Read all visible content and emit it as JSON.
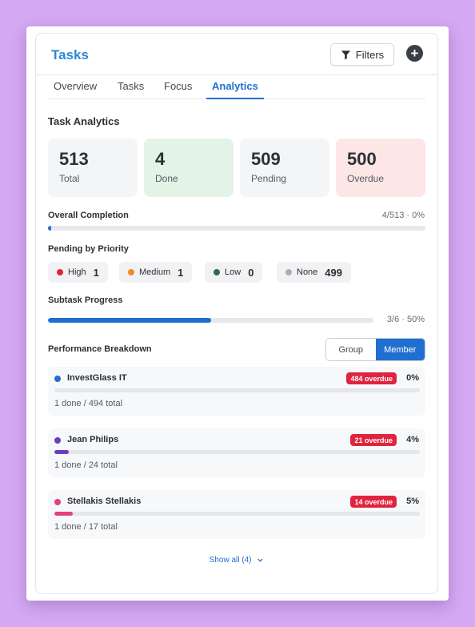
{
  "header": {
    "title": "Tasks",
    "filters_label": "Filters",
    "add_symbol": "+"
  },
  "tabs": [
    "Overview",
    "Tasks",
    "Focus",
    "Analytics"
  ],
  "active_tab": "Analytics",
  "analytics": {
    "title": "Task Analytics",
    "stats": [
      {
        "value": "513",
        "label": "Total",
        "bg": "#f4f5f6"
      },
      {
        "value": "4",
        "label": "Done",
        "bg": "#e3f3e6"
      },
      {
        "value": "509",
        "label": "Pending",
        "bg": "#f4f5f6"
      },
      {
        "value": "500",
        "label": "Overdue",
        "bg": "#fde6e6"
      }
    ],
    "completion": {
      "label": "Overall Completion",
      "summary": "4/513 · 0%",
      "fraction": 0.0078
    },
    "priority": {
      "label": "Pending by Priority",
      "items": [
        {
          "name": "High",
          "count": "1",
          "color": "#e0243e"
        },
        {
          "name": "Medium",
          "count": "1",
          "color": "#f08a2a"
        },
        {
          "name": "Low",
          "count": "0",
          "color": "#2f6b4a"
        },
        {
          "name": "None",
          "count": "499",
          "color": "#a9aeb5"
        }
      ]
    },
    "subtasks": {
      "label": "Subtask Progress",
      "summary": "3/6 · 50%",
      "fraction": 0.5
    },
    "performance": {
      "label": "Performance Breakdown",
      "toggle": [
        "Group",
        "Member"
      ],
      "active_toggle": "Member",
      "members": [
        {
          "name": "InvestGlass IT",
          "overdue": "484 overdue",
          "percent": "0%",
          "fraction": 0.0,
          "totals": "1 done / 494 total",
          "color": "#1f6fd1"
        },
        {
          "name": "Jean Philips",
          "overdue": "21 overdue",
          "percent": "4%",
          "fraction": 0.04,
          "totals": "1 done / 24 total",
          "color": "#6b3fc0"
        },
        {
          "name": "Stellakis Stellakis",
          "overdue": "14 overdue",
          "percent": "5%",
          "fraction": 0.05,
          "totals": "1 done / 17 total",
          "color": "#e0427a"
        }
      ],
      "show_all": "Show all (4)"
    }
  },
  "colors": {
    "accent": "#1f6fd1",
    "title": "#2f86d8",
    "danger": "#e0243e"
  }
}
